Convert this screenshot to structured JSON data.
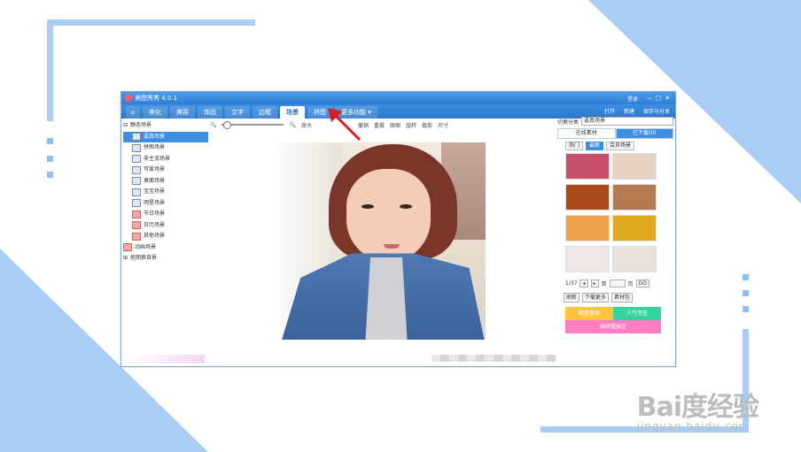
{
  "app": {
    "title": "美图秀秀 4.0.1",
    "login_label": "登录",
    "window_controls": [
      "—",
      "□",
      "✕"
    ]
  },
  "nav": {
    "tabs": [
      "美化",
      "美容",
      "饰品",
      "文字",
      "边框",
      "场景",
      "拼图",
      "更多功能 ▾"
    ],
    "active": "场景",
    "right_actions": [
      "打开",
      "新建",
      "保存与分享"
    ]
  },
  "toolbar": {
    "zoom_in": "原大",
    "undo": "撤销",
    "redo": "重做",
    "reset": "原图",
    "rotate": "旋转",
    "crop": "裁剪",
    "resize": "尺寸"
  },
  "left_panel": {
    "static_label": "静态场景",
    "items": [
      {
        "label": "逼真场景",
        "selected": true
      },
      {
        "label": "拼图场景"
      },
      {
        "label": "非主流场景"
      },
      {
        "label": "可爱场景"
      },
      {
        "label": "桌面场景"
      },
      {
        "label": "宝宝场景"
      },
      {
        "label": "明星场景"
      },
      {
        "label": "节日场景"
      },
      {
        "label": "日历场景"
      },
      {
        "label": "其他场景"
      }
    ],
    "animated_label": "动画场景",
    "scene_bg_label": "抠图换背景"
  },
  "right_panel": {
    "category_label": "切换分类",
    "category_value": "逼真场景",
    "tabs": [
      "在线素材",
      "已下载(0)"
    ],
    "subtabs": [
      "热门",
      "最新",
      "会员场景"
    ],
    "thumb_colors": [
      "#c9526a",
      "#e6d2c2",
      "#a84a1a",
      "#b67a52",
      "#f0a34a",
      "#e0a81c",
      "#efe6e6",
      "#e8e1dc"
    ],
    "pager_text": "1/37",
    "pager_prev": "◂",
    "pager_next": "▸",
    "goto_label": "到",
    "page_unit": "页",
    "go_label": "GO",
    "refresh_label": "刷新",
    "download_more_label": "下载更多",
    "material_pack_label": "素材包",
    "banner_items": [
      "精选美场",
      "人气专区",
      "高颜值景区"
    ]
  },
  "watermark": {
    "main": "Bai度经验",
    "sub": "jingyan.baidu.com"
  }
}
